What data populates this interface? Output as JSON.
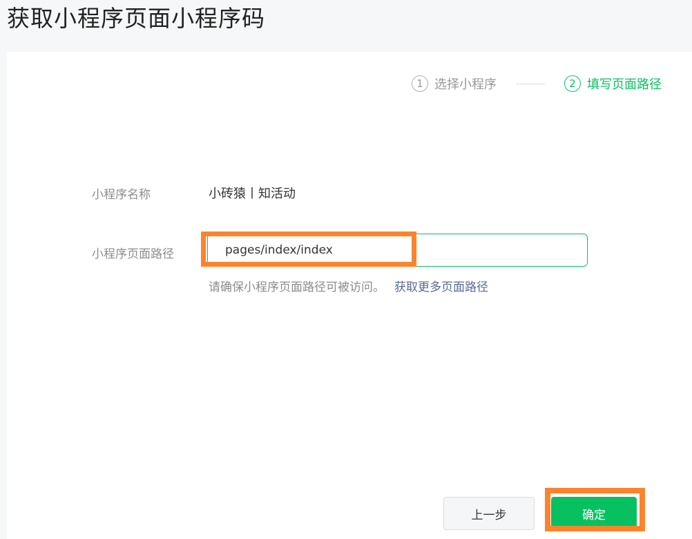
{
  "page": {
    "title": "获取小程序页面小程序码"
  },
  "stepper": {
    "steps": [
      {
        "number": "1",
        "label": "选择小程序",
        "active": false
      },
      {
        "number": "2",
        "label": "填写页面路径",
        "active": true
      }
    ]
  },
  "form": {
    "name_label": "小程序名称",
    "name_value": "小砖猿丨知活动",
    "path_label": "小程序页面路径",
    "path_value": "pages/index/index",
    "hint_text": "请确保小程序页面路径可被访问。",
    "hint_link": "获取更多页面路径"
  },
  "actions": {
    "prev_label": "上一步",
    "confirm_label": "确定"
  },
  "colors": {
    "accent": "#07c160",
    "link": "#576b95",
    "highlight": "#fd832c"
  }
}
